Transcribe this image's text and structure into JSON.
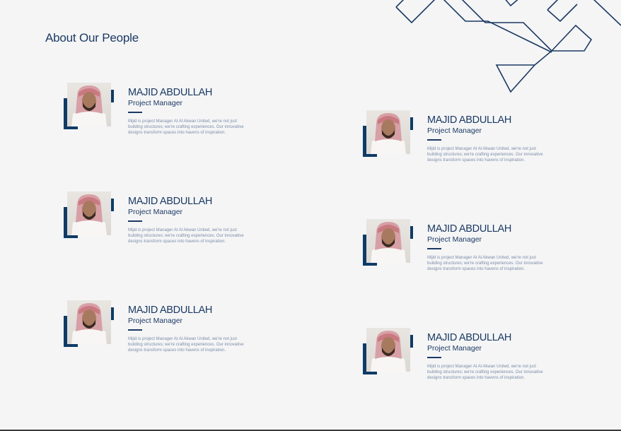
{
  "page": {
    "title": "About Our People"
  },
  "colors": {
    "primary": "#1b3a63",
    "frame": "#0f3b66",
    "bio_text": "#7d8ea8",
    "background": "#f5f5f6"
  },
  "people": [
    {
      "name": "MAJID ABDULLAH",
      "role": "Project Manager",
      "bio": "Mijid is project Manager At Al Akwan United, we're not just building structures; we're crafting experiences. Our innovative designs transform spaces into havens of inspiration.",
      "photo_icon": "person-portrait-icon"
    },
    {
      "name": "MAJID ABDULLAH",
      "role": "Project Manager",
      "bio": "Mijid is project Manager At Al Akwan United, we're not just building structures; we're crafting experiences. Our innovative designs transform spaces into havens of inspiration.",
      "photo_icon": "person-portrait-icon"
    },
    {
      "name": "MAJID ABDULLAH",
      "role": "Project Manager",
      "bio": "Mijid is project Manager At Al Akwan United, we're not just building structures; we're crafting experiences. Our innovative designs transform spaces into havens of inspiration.",
      "photo_icon": "person-portrait-icon"
    },
    {
      "name": "MAJID ABDULLAH",
      "role": "Project Manager",
      "bio": "Mijid is project Manager At Al Akwan United, we're not just building structures; we're crafting experiences. Our innovative designs transform spaces into havens of inspiration.",
      "photo_icon": "person-portrait-icon"
    },
    {
      "name": "MAJID ABDULLAH",
      "role": "Project Manager",
      "bio": "Mijid is project Manager At Al Akwan United, we're not just building structures; we're crafting experiences. Our innovative designs transform spaces into havens of inspiration.",
      "photo_icon": "person-portrait-icon"
    },
    {
      "name": "MAJID ABDULLAH",
      "role": "Project Manager",
      "bio": "Mijid is project Manager At Al Akwan United, we're not just building structures; we're crafting experiences. Our innovative designs transform spaces into havens of inspiration.",
      "photo_icon": "person-portrait-icon"
    }
  ]
}
